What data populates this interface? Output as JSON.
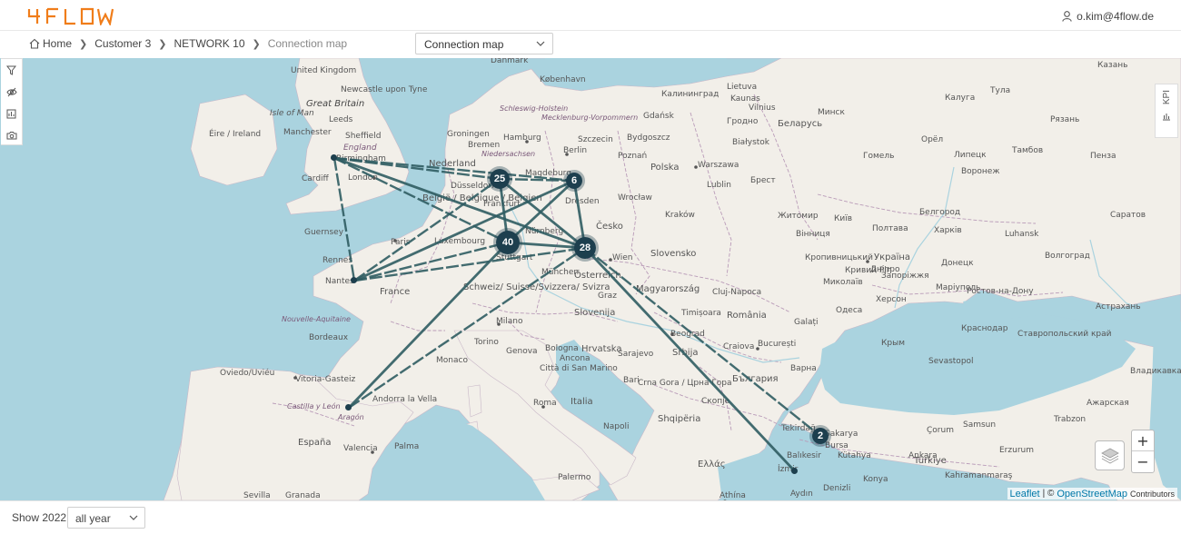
{
  "app": {
    "logo_text": "4FLOW",
    "brand_color": "#f07d1a",
    "user_email": "o.kim@4flow.de"
  },
  "breadcrumb": {
    "home": "Home",
    "items": [
      "Customer 3",
      "NETWORK 10"
    ],
    "current": "Connection map"
  },
  "view_select": {
    "value": "Connection map"
  },
  "map": {
    "city_labels": [
      {
        "name": "United Kingdom"
      },
      {
        "name": "Great Britain"
      },
      {
        "name": "Isle of Man"
      },
      {
        "name": "Newcastle upon Tyne"
      },
      {
        "name": "Leeds"
      },
      {
        "name": "Manchester"
      },
      {
        "name": "Sheffield"
      },
      {
        "name": "Éire / Ireland"
      },
      {
        "name": "Birmingham"
      },
      {
        "name": "Cardiff"
      },
      {
        "name": "London"
      },
      {
        "name": "England"
      },
      {
        "name": "Guernsey"
      },
      {
        "name": "Rennes"
      },
      {
        "name": "Nantes"
      },
      {
        "name": "Paris"
      },
      {
        "name": "France"
      },
      {
        "name": "Nederland"
      },
      {
        "name": "Groningen"
      },
      {
        "name": "Hamburg"
      },
      {
        "name": "Bremen"
      },
      {
        "name": "Berlin"
      },
      {
        "name": "Szczecin"
      },
      {
        "name": "Gdańsk"
      },
      {
        "name": "Bydgoszcz"
      },
      {
        "name": "Poznań"
      },
      {
        "name": "Polska"
      },
      {
        "name": "Warszawa"
      },
      {
        "name": "Lublin"
      },
      {
        "name": "Magdeburg"
      },
      {
        "name": "Dresden"
      },
      {
        "name": "Düsseldorf"
      },
      {
        "name": "Frankfurt"
      },
      {
        "name": "Luxembourg"
      },
      {
        "name": "België / Belgique / Belgien"
      },
      {
        "name": "Nürnberg"
      },
      {
        "name": "Stuttgart"
      },
      {
        "name": "München"
      },
      {
        "name": "Česko"
      },
      {
        "name": "Wrocław"
      },
      {
        "name": "Kraków"
      },
      {
        "name": "Slovensko"
      },
      {
        "name": "Wien"
      },
      {
        "name": "Österreich"
      },
      {
        "name": "Magyarország"
      },
      {
        "name": "Schweiz/ Suisse/Svizzera/ Svizra"
      },
      {
        "name": "Milano"
      },
      {
        "name": "Torino"
      },
      {
        "name": "Genova"
      },
      {
        "name": "Bologna"
      },
      {
        "name": "Slovenija"
      },
      {
        "name": "Graz"
      },
      {
        "name": "Hrvatska"
      },
      {
        "name": "Italia"
      },
      {
        "name": "Roma"
      },
      {
        "name": "Napoli"
      },
      {
        "name": "Palermo"
      },
      {
        "name": "Monaco"
      },
      {
        "name": "Città di San Marino"
      },
      {
        "name": "Ancona"
      },
      {
        "name": "Bari"
      },
      {
        "name": "Oviedo/Uviéu"
      },
      {
        "name": "Vitoria-Gasteiz"
      },
      {
        "name": "Andorra la Vella"
      },
      {
        "name": "España"
      },
      {
        "name": "Valencia"
      },
      {
        "name": "Palma"
      },
      {
        "name": "Sevilla"
      },
      {
        "name": "Granada"
      },
      {
        "name": "Aragón"
      },
      {
        "name": "Castilla y León"
      },
      {
        "name": "Nouvelle-Aquitaine"
      },
      {
        "name": "Bordeaux"
      },
      {
        "name": "Srbija"
      },
      {
        "name": "Beograd"
      },
      {
        "name": "România"
      },
      {
        "name": "București"
      },
      {
        "name": "Cluj-Napoca"
      },
      {
        "name": "Timișoara"
      },
      {
        "name": "Craiova"
      },
      {
        "name": "Galați"
      },
      {
        "name": "Одеса"
      },
      {
        "name": "Україна"
      },
      {
        "name": "Київ"
      },
      {
        "name": "Lietuva"
      },
      {
        "name": "Kaunas"
      },
      {
        "name": "Vilnius"
      },
      {
        "name": "Беларусь"
      },
      {
        "name": "Гродно"
      },
      {
        "name": "Białystok"
      },
      {
        "name": "Брест"
      },
      {
        "name": "Минск"
      },
      {
        "name": "Гомель"
      },
      {
        "name": "Житомир"
      },
      {
        "name": "Вінниця"
      },
      {
        "name": "Кропивницький"
      },
      {
        "name": "Кривий Ріг"
      },
      {
        "name": "Запоріжжя"
      },
      {
        "name": "Харків"
      },
      {
        "name": "Дніпро"
      },
      {
        "name": "Полтава"
      },
      {
        "name": "Маріуполь"
      },
      {
        "name": "Миколаїв"
      },
      {
        "name": "Херсон"
      },
      {
        "name": "Ростов-на-Дону"
      },
      {
        "name": "Краснодар"
      },
      {
        "name": "Астрахань"
      },
      {
        "name": "Волгоград"
      },
      {
        "name": "Воронеж"
      },
      {
        "name": "Липецк"
      },
      {
        "name": "Орёл"
      },
      {
        "name": "Калуга"
      },
      {
        "name": "Тула"
      },
      {
        "name": "Казань"
      },
      {
        "name": "Рязань"
      },
      {
        "name": "Тамбов"
      },
      {
        "name": "Пенза"
      },
      {
        "name": "Саратов"
      },
      {
        "name": "Белгород"
      },
      {
        "name": "Донецк"
      },
      {
        "name": "Luhansk"
      },
      {
        "name": "Крым"
      },
      {
        "name": "Sakarya"
      },
      {
        "name": "Bursa"
      },
      {
        "name": "Kütahya"
      },
      {
        "name": "Balıkesir"
      },
      {
        "name": "İzmir"
      },
      {
        "name": "Denizli"
      },
      {
        "name": "Konya"
      },
      {
        "name": "Aydın"
      },
      {
        "name": "Türkiye"
      },
      {
        "name": "Erzurum"
      },
      {
        "name": "Çorum"
      },
      {
        "name": "Samsun"
      },
      {
        "name": "Trabzon"
      },
      {
        "name": "Ankara"
      },
      {
        "name": "Tekirdağ"
      },
      {
        "name": "Варна"
      },
      {
        "name": "България"
      },
      {
        "name": "Скопје"
      },
      {
        "name": "Shqipëria"
      },
      {
        "name": "Crna Gora / Црна Гора"
      },
      {
        "name": "Ελλάς"
      },
      {
        "name": "Athína"
      },
      {
        "name": "Sarajevo"
      },
      {
        "name": "Kahramanmaraş"
      },
      {
        "name": "Ажарская"
      },
      {
        "name": "Владикавказ"
      },
      {
        "name": "Ставропольский край"
      },
      {
        "name": "Dânmark"
      },
      {
        "name": "København"
      },
      {
        "name": "Калининград"
      },
      {
        "name": "Schleswig-Holstein"
      },
      {
        "name": "Mecklenburg-Vorpommern"
      },
      {
        "name": "Niedersachsen"
      },
      {
        "name": "Sevastopol"
      }
    ],
    "hubs": [
      {
        "id": "birmingham",
        "count": ""
      },
      {
        "id": "nantes",
        "count": ""
      },
      {
        "id": "aragon",
        "count": ""
      },
      {
        "id": "dusseldorf",
        "count": "25"
      },
      {
        "id": "magdeburg",
        "count": "6"
      },
      {
        "id": "stuttgart",
        "count": "40"
      },
      {
        "id": "vienna",
        "count": "28"
      },
      {
        "id": "bursa",
        "count": "2"
      },
      {
        "id": "izmir",
        "count": ""
      }
    ],
    "route_color": "#2f5c62",
    "hub_color": "#1d3f4e",
    "land_color": "#f2efe9",
    "water_color": "#aad3df"
  },
  "tools": {
    "filter": "filter-icon",
    "visibility": "eye-off-icon",
    "report": "report-icon",
    "snapshot": "camera-icon",
    "kpi_label": "KPI"
  },
  "zoom": {
    "in": "+",
    "out": "−"
  },
  "attribution": {
    "leaflet": "Leaflet",
    "sep": "| ©",
    "osm": "OpenStreetMap",
    "contrib": "Contributors"
  },
  "footer": {
    "show_label": "Show 2022",
    "period_value": "all year"
  }
}
